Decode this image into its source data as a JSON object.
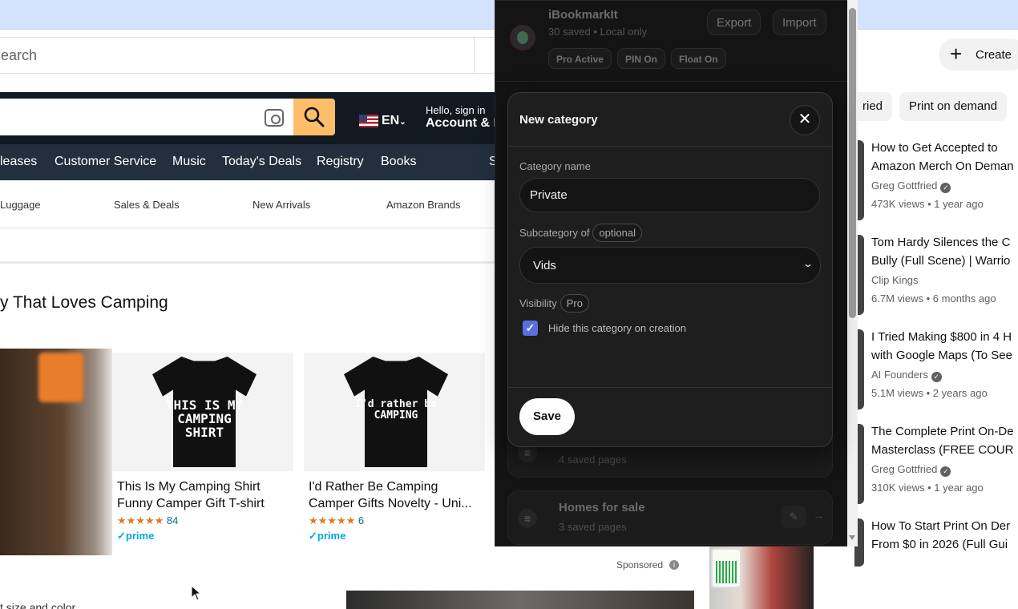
{
  "browser": {
    "search_placeholder": "earch"
  },
  "amazon": {
    "lang": "EN",
    "hello": "Hello, sign in",
    "account": "Account & L",
    "nav": [
      "leases",
      "Customer Service",
      "Music",
      "Today's Deals",
      "Registry",
      "Books",
      "S"
    ],
    "subnav": [
      "Luggage",
      "Sales & Deals",
      "New Arrivals",
      "Amazon Brands"
    ],
    "section_title": "y That Loves Camping",
    "products": [
      {
        "shirt_text": "THIS IS MY CAMPING SHIRT",
        "title": "This Is My Camping Shirt Funny Camper Gift T-shirt",
        "stars": "★★★★★",
        "reviews": "84",
        "prime": "✓prime"
      },
      {
        "shirt_text": "I'd rather be CAMPING",
        "title": "I'd Rather Be Camping Camper Gifts Novelty - Uni...",
        "stars": "★★★★★",
        "reviews": "6",
        "prime": "✓prime"
      }
    ],
    "sponsored": "Sponsored",
    "size_color": "t size and color"
  },
  "youtube": {
    "create": "Create",
    "chips": [
      "ried",
      "Print on demand"
    ],
    "videos": [
      {
        "title1": "How to Get Accepted to",
        "title2": "Amazon Merch On Deman",
        "channel": "Greg Gottfried",
        "verified": true,
        "meta": "473K views • 1 year ago"
      },
      {
        "title1": "Tom Hardy Silences the C",
        "title2": "Bully (Full Scene) | Warrio",
        "channel": "Clip Kings",
        "verified": false,
        "meta": "6.7M views • 6 months ago"
      },
      {
        "title1": "I Tried Making $800 in 4 H",
        "title2": "with Google Maps (To See",
        "channel": "AI Founders",
        "verified": true,
        "meta": "5.1M views • 2 years ago"
      },
      {
        "title1": "The Complete Print On-De",
        "title2": "Masterclass (FREE COUR",
        "channel": "Greg Gottfried",
        "verified": true,
        "meta": "310K views • 1 year ago"
      },
      {
        "title1": "How To Start Print On Der",
        "title2": "From $0 in 2026 (Full Gui",
        "channel": "",
        "verified": false,
        "meta": ""
      }
    ]
  },
  "extension": {
    "title": "iBookmarkIt",
    "subtitle": "30 saved • Local only",
    "export": "Export",
    "import": "Import",
    "pills": [
      "Pro Active",
      "PIN On",
      "Float On"
    ],
    "bg_categories": [
      {
        "name": "",
        "count": "4 saved pages"
      },
      {
        "name": "Homes for sale",
        "count": "3 saved pages"
      }
    ],
    "modal": {
      "title": "New category",
      "close": "✕",
      "name_label": "Category name",
      "name_value": "Private",
      "parent_label": "Subcategory of",
      "parent_tag": "optional",
      "parent_value": "Vids",
      "visibility_label": "Visibility",
      "visibility_tag": "Pro",
      "hide_label": "Hide this category on creation",
      "hide_checked": true,
      "save": "Save"
    }
  }
}
